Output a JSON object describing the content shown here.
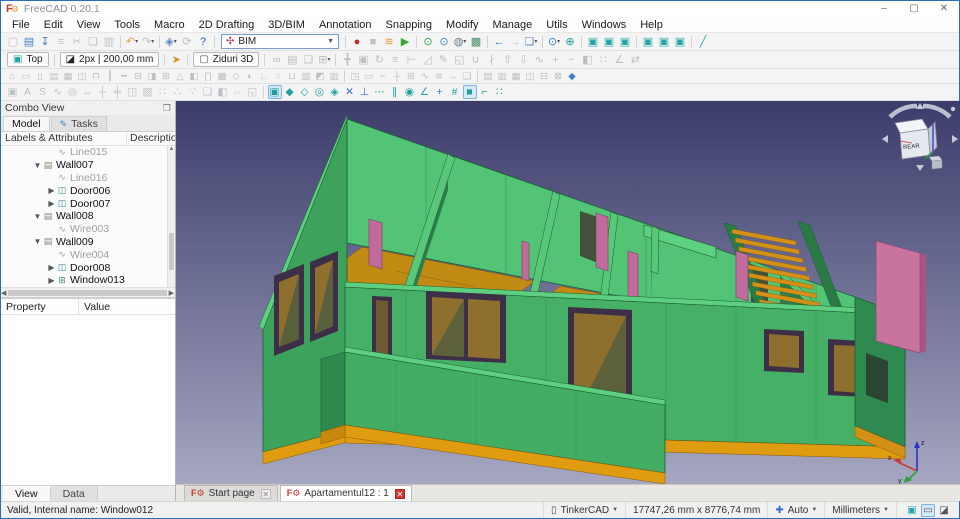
{
  "window": {
    "title": "FreeCAD 0.20.1",
    "controls": [
      {
        "name": "minimize-button",
        "glyph": "–"
      },
      {
        "name": "maximize-button",
        "glyph": "▢"
      },
      {
        "name": "close-button",
        "glyph": "✕"
      }
    ]
  },
  "menu": [
    "File",
    "Edit",
    "View",
    "Tools",
    "Macro",
    "2D Drafting",
    "3D/BIM",
    "Annotation",
    "Snapping",
    "Modify",
    "Manage",
    "Utils",
    "Windows",
    "Help"
  ],
  "toolbars": {
    "row1": [
      {
        "type": "group",
        "name": "file-toolbar",
        "items": [
          {
            "n": "new-file-icon",
            "g": "▢",
            "d": 1
          },
          {
            "n": "open-file-icon",
            "g": "▤",
            "c": "#3f7fc4"
          },
          {
            "n": "save-icon",
            "g": "↧",
            "c": "#3f7fc4"
          },
          {
            "n": "print-icon",
            "g": "≡",
            "d": 1
          },
          {
            "n": "cut-icon",
            "g": "✂",
            "d": 1
          },
          {
            "n": "copy-icon",
            "g": "❏",
            "d": 1
          },
          {
            "n": "paste-icon",
            "g": "▥",
            "d": 1
          }
        ]
      },
      {
        "type": "group",
        "name": "undo-redo-toolbar",
        "items": [
          {
            "n": "undo-icon",
            "g": "↶",
            "c": "#e8a33d",
            "dd": 1
          },
          {
            "n": "redo-icon",
            "g": "↷",
            "d": 1,
            "dd": 1
          }
        ]
      },
      {
        "type": "group",
        "name": "workbench-tools",
        "items": [
          {
            "n": "workbench-icon",
            "g": "◈",
            "c": "#5b8ac4",
            "dd": 1
          },
          {
            "n": "refresh-icon",
            "g": "⟳",
            "d": 1
          },
          {
            "n": "whats-this-icon",
            "g": "?",
            "c": "#2a5fa8"
          }
        ]
      },
      {
        "type": "combo",
        "name": "workbench-selector",
        "icon_glyph": "✣",
        "icon_color": "#c03a52",
        "value": "BIM"
      },
      {
        "type": "group",
        "name": "macro-toolbar",
        "items": [
          {
            "n": "macro-record-icon",
            "g": "●",
            "c": "#cc2626"
          },
          {
            "n": "macro-stop-icon",
            "g": "■",
            "d": 1
          },
          {
            "n": "macro-edit-icon",
            "g": "≋",
            "c": "#e8952a"
          },
          {
            "n": "macro-play-icon",
            "g": "▶",
            "c": "#3aa73a"
          }
        ]
      },
      {
        "type": "group",
        "name": "view-zoom-toolbar",
        "items": [
          {
            "n": "zoom-selection-icon",
            "g": "⊙",
            "c": "#2e9e4f"
          },
          {
            "n": "zoom-icon",
            "g": "⊙",
            "c": "#3f7fc4"
          },
          {
            "n": "draw-style-icon",
            "g": "◍",
            "c": "#6a7f8f",
            "dd": 1
          },
          {
            "n": "texture-view-icon",
            "g": "▩",
            "c": "#4a8f6a"
          }
        ]
      },
      {
        "type": "group",
        "name": "nav-history-toolbar",
        "items": [
          {
            "n": "nav-back-icon",
            "g": "←",
            "c": "#3f7fc4"
          },
          {
            "n": "nav-forward-icon",
            "g": "→",
            "d": 1
          },
          {
            "n": "linked-view-icon",
            "g": "❏",
            "c": "#5b8ac4",
            "dd": 1
          }
        ]
      },
      {
        "type": "group",
        "name": "zoom-fit-toolbar",
        "items": [
          {
            "n": "zoom-in-icon",
            "g": "⊙",
            "c": "#3f7fc4",
            "dd": 1
          },
          {
            "n": "fit-all-icon",
            "g": "⊕",
            "c": "#1f9e9e"
          }
        ]
      },
      {
        "type": "group",
        "name": "std-views-toolbar-1",
        "items": [
          {
            "n": "axonometric-view-icon",
            "g": "▣",
            "c": "#25a7a7"
          },
          {
            "n": "front-view-icon",
            "g": "▣",
            "c": "#25a7a7"
          },
          {
            "n": "top-view-icon",
            "g": "▣",
            "c": "#25a7a7"
          }
        ]
      },
      {
        "type": "group",
        "name": "std-views-toolbar-2",
        "items": [
          {
            "n": "right-view-icon",
            "g": "▣",
            "c": "#25a7a7"
          },
          {
            "n": "rear-view-icon",
            "g": "▣",
            "c": "#25a7a7"
          },
          {
            "n": "bottom-view-icon",
            "g": "▣",
            "c": "#25a7a7"
          }
        ]
      },
      {
        "type": "group",
        "name": "measure-toolbar",
        "items": [
          {
            "n": "measure-icon",
            "g": "╱",
            "c": "#25a7a7"
          }
        ]
      }
    ],
    "row2": [
      {
        "type": "button",
        "name": "current-view-button",
        "glyph": "▣",
        "glyph_color": "#25a7a7",
        "label": "Top"
      },
      {
        "type": "button",
        "name": "line-style-button",
        "glyph": "◪",
        "glyph_color": "#222222",
        "label": "2px | 200,00 mm"
      },
      {
        "type": "group",
        "name": "working-plane-toolbar",
        "items": [
          {
            "n": "working-plane-arrow-icon",
            "g": "➤",
            "c": "#d88c2a"
          }
        ]
      },
      {
        "type": "button",
        "name": "walls-3d-button",
        "glyph": "▢",
        "glyph_color": "#555555",
        "label": "Ziduri 3D"
      },
      {
        "type": "group",
        "name": "group-tools",
        "items": [
          {
            "n": "link-icon",
            "g": "∞",
            "d": 1
          },
          {
            "n": "make-group-icon",
            "g": "▤",
            "d": 1
          },
          {
            "n": "move-to-group-icon",
            "g": "❏",
            "d": 1
          },
          {
            "n": "share-icon",
            "g": "⊞",
            "d": 1,
            "dd": 1
          }
        ]
      },
      {
        "type": "group",
        "name": "modify-tools",
        "items": [
          {
            "n": "draft-move-icon",
            "g": "╋",
            "d": 1
          },
          {
            "n": "draft-copy-icon",
            "g": "▣",
            "d": 1
          },
          {
            "n": "draft-rotate-icon",
            "g": "↻",
            "d": 1
          },
          {
            "n": "draft-offset-icon",
            "g": "≡",
            "d": 1
          },
          {
            "n": "draft-trimex-icon",
            "g": "⊢",
            "d": 1
          },
          {
            "n": "draft-scale-icon",
            "g": "◿",
            "d": 1
          },
          {
            "n": "draft-edit-icon",
            "g": "✎",
            "d": 1
          },
          {
            "n": "draft-subelement-icon",
            "g": "◱",
            "d": 1
          },
          {
            "n": "draft-join-icon",
            "g": "∪",
            "d": 1
          },
          {
            "n": "draft-split-icon",
            "g": "∤",
            "d": 1
          },
          {
            "n": "draft-upgrade-icon",
            "g": "⇧",
            "d": 1
          },
          {
            "n": "draft-downgrade-icon",
            "g": "⇩",
            "d": 1
          },
          {
            "n": "draft-wire-to-spline-icon",
            "g": "∿",
            "d": 1
          },
          {
            "n": "draft-add-point-icon",
            "g": "+",
            "d": 1
          },
          {
            "n": "draft-remove-point-icon",
            "g": "−",
            "d": 1
          },
          {
            "n": "draft-mirror-icon",
            "g": "◧",
            "d": 1
          },
          {
            "n": "draft-array-icon",
            "g": "∷",
            "d": 1
          },
          {
            "n": "draft-slope-icon",
            "g": "∠",
            "d": 1
          },
          {
            "n": "draft-invert-icon",
            "g": "⇄",
            "d": 1
          }
        ]
      }
    ],
    "row3": [
      {
        "type": "group",
        "name": "bim-tools",
        "items": [
          {
            "n": "bim-project-icon",
            "g": "⌂",
            "d": 1
          },
          {
            "n": "bim-site-icon",
            "g": "▭",
            "d": 1
          },
          {
            "n": "bim-building-icon",
            "g": "▯",
            "d": 1
          },
          {
            "n": "bim-level-icon",
            "g": "▤",
            "d": 1
          },
          {
            "n": "bim-space-icon",
            "g": "▦",
            "d": 1
          },
          {
            "n": "bim-wall-icon",
            "g": "◫",
            "d": 1
          },
          {
            "n": "bim-curtain-wall-icon",
            "g": "⊓",
            "d": 1
          },
          {
            "n": "bim-column-icon",
            "g": "┃",
            "d": 1
          },
          {
            "n": "bim-beam-icon",
            "g": "━",
            "d": 1
          },
          {
            "n": "bim-slab-icon",
            "g": "⊟",
            "d": 1
          },
          {
            "n": "bim-door-icon",
            "g": "◨",
            "d": 1
          },
          {
            "n": "bim-window-icon",
            "g": "⊞",
            "d": 1
          },
          {
            "n": "bim-roof-icon",
            "g": "△",
            "d": 1
          },
          {
            "n": "bim-panel-icon",
            "g": "◧",
            "d": 1
          },
          {
            "n": "bim-frame-icon",
            "g": "∏",
            "d": 1
          },
          {
            "n": "bim-fence-icon",
            "g": "▩",
            "d": 1
          },
          {
            "n": "bim-truss-icon",
            "g": "◇",
            "d": 1
          },
          {
            "n": "bim-equipment-icon",
            "g": "◐",
            "d": 1
          },
          {
            "n": "bim-rebar-icon",
            "g": "∟",
            "d": 1
          },
          {
            "n": "bim-pipe-icon",
            "g": "○",
            "d": 1
          },
          {
            "n": "bim-connector-icon",
            "g": "⊔",
            "d": 1
          },
          {
            "n": "bim-stairs-icon",
            "g": "▨",
            "d": 1
          },
          {
            "n": "bim-material-icon",
            "g": "◩",
            "d": 1
          },
          {
            "n": "bim-schedule-icon",
            "g": "▥",
            "d": 1
          }
        ]
      },
      {
        "type": "group",
        "name": "bim-annotation-tools",
        "items": [
          {
            "n": "bim-section-plane-icon",
            "g": "◳",
            "d": 1
          },
          {
            "n": "bim-drawing-icon",
            "g": "▭",
            "d": 1
          },
          {
            "n": "bim-annotation-icon",
            "g": "⌐",
            "d": 1
          },
          {
            "n": "bim-axis-icon",
            "g": "┼",
            "d": 1
          },
          {
            "n": "bim-grid-icon",
            "g": "⊞",
            "d": 1
          },
          {
            "n": "bim-sketch-icon",
            "g": "∿",
            "d": 1
          },
          {
            "n": "bim-text-icon",
            "g": "≋",
            "d": 1
          },
          {
            "n": "bim-dimension-icon",
            "g": "↔",
            "d": 1
          },
          {
            "n": "bim-clone-icon",
            "g": "❏",
            "d": 1
          }
        ]
      },
      {
        "type": "group",
        "name": "ifc-tools",
        "items": [
          {
            "n": "ifc-explore-icon",
            "g": "▤",
            "d": 1
          },
          {
            "n": "ifc-diff-icon",
            "g": "▥",
            "d": 1
          },
          {
            "n": "ifc-expand-icon",
            "g": "▦",
            "d": 1
          },
          {
            "n": "ifc-compress-icon",
            "g": "◫",
            "d": 1
          },
          {
            "n": "ifc-convert-icon",
            "g": "⊟",
            "d": 1
          },
          {
            "n": "ifc-lock-icon",
            "g": "⊠",
            "d": 1
          },
          {
            "n": "views-manager-icon",
            "g": "◆",
            "c": "#3f7fc4"
          }
        ]
      }
    ],
    "row4": [
      {
        "type": "group",
        "name": "draft-annotation-tools",
        "items": [
          {
            "n": "image-plane-icon",
            "g": "▣",
            "d": 1
          },
          {
            "n": "shape-text-icon",
            "g": "A",
            "d": 1
          },
          {
            "n": "shape-string-icon",
            "g": "S",
            "d": 1
          },
          {
            "n": "bezier-icon",
            "g": "∿",
            "d": 1
          },
          {
            "n": "label-icon",
            "g": "◎",
            "d": 1
          },
          {
            "n": "dimension-icon",
            "g": "↔",
            "d": 1
          },
          {
            "n": "axis-icon",
            "g": "┼",
            "d": 1
          },
          {
            "n": "axis-system-icon",
            "g": "╪",
            "d": 1
          },
          {
            "n": "section-icon",
            "g": "◫",
            "d": 1
          },
          {
            "n": "hatch-icon",
            "g": "▨",
            "d": 1
          },
          {
            "n": "ortho-array-icon",
            "g": "∷",
            "d": 1
          },
          {
            "n": "path-array-icon",
            "g": "∴",
            "d": 1
          },
          {
            "n": "point-array-icon",
            "g": "∵",
            "d": 1
          },
          {
            "n": "clone-icon",
            "g": "❏",
            "d": 1
          },
          {
            "n": "mirror-icon",
            "g": "◧",
            "d": 1
          },
          {
            "n": "stretch-icon",
            "g": "⇔",
            "d": 1
          },
          {
            "n": "shape-2d-view-icon",
            "g": "◱",
            "d": 1
          }
        ]
      },
      {
        "type": "group",
        "name": "snapping-toolbar",
        "items": [
          {
            "n": "snap-lock-icon",
            "g": "▣",
            "c": "#1f9e9e",
            "a": 1
          },
          {
            "n": "snap-endpoint-icon",
            "g": "◆",
            "c": "#1f9e9e"
          },
          {
            "n": "snap-midpoint-icon",
            "g": "◇",
            "c": "#1f9e9e"
          },
          {
            "n": "snap-center-icon",
            "g": "◎",
            "c": "#1f9e9e"
          },
          {
            "n": "snap-angle-icon",
            "g": "◈",
            "c": "#1f9e9e"
          },
          {
            "n": "snap-intersection-icon",
            "g": "✕",
            "c": "#2f6fd0"
          },
          {
            "n": "snap-perpendicular-icon",
            "g": "⊥",
            "c": "#2f6fd0"
          },
          {
            "n": "snap-extension-icon",
            "g": "⋯",
            "c": "#1f9e9e"
          },
          {
            "n": "snap-parallel-icon",
            "g": "∥",
            "c": "#1f9e9e"
          },
          {
            "n": "snap-special-icon",
            "g": "◉",
            "c": "#1f9e9e"
          },
          {
            "n": "snap-near-icon",
            "g": "∠",
            "c": "#1f9e9e"
          },
          {
            "n": "snap-ortho-icon",
            "g": "+",
            "c": "#2f6fd0"
          },
          {
            "n": "snap-grid-icon",
            "g": "#",
            "c": "#1f9e9e"
          },
          {
            "n": "snap-working-plane-icon",
            "g": "■",
            "c": "#1f9e9e",
            "a": 1
          },
          {
            "n": "snap-dimensions-icon",
            "g": "⌐",
            "c": "#1f9e9e"
          },
          {
            "n": "toggle-grid-icon",
            "g": "∷",
            "c": "#1f9e9e"
          }
        ]
      }
    ]
  },
  "combo_view": {
    "title": "Combo View",
    "tabs": [
      {
        "label": "Model",
        "active": true
      },
      {
        "label": "Tasks",
        "active": false,
        "icon": "✎"
      }
    ],
    "tree_header": {
      "col1": "Labels & Attributes",
      "col2": "Descriptio"
    },
    "icon_map": {
      "line": {
        "g": "∿",
        "c": "#9aa0a6"
      },
      "wall": {
        "g": "▤",
        "c": "#7d8a70"
      },
      "door": {
        "g": "◫",
        "c": "#3f8f8f"
      },
      "window": {
        "g": "⊞",
        "c": "#3f8f8f"
      }
    },
    "tree": [
      {
        "label": "Line015",
        "icon": "line",
        "depth": 2,
        "muted": true
      },
      {
        "label": "Wall007",
        "icon": "wall",
        "depth": 1,
        "expanded": true
      },
      {
        "label": "Line016",
        "icon": "line",
        "depth": 2,
        "muted": true
      },
      {
        "label": "Door006",
        "icon": "door",
        "depth": 2,
        "collapsed": true
      },
      {
        "label": "Door007",
        "icon": "door",
        "depth": 2,
        "collapsed": true
      },
      {
        "label": "Wall008",
        "icon": "wall",
        "depth": 1,
        "expanded": true
      },
      {
        "label": "Wire003",
        "icon": "line",
        "depth": 2,
        "muted": true
      },
      {
        "label": "Wall009",
        "icon": "wall",
        "depth": 1,
        "expanded": true
      },
      {
        "label": "Wire004",
        "icon": "line",
        "depth": 2,
        "muted": true
      },
      {
        "label": "Door008",
        "icon": "door",
        "depth": 2,
        "collapsed": true
      },
      {
        "label": "Window013",
        "icon": "window",
        "depth": 2,
        "collapsed": true
      }
    ],
    "property_table": {
      "columns": [
        "Property",
        "Value"
      ],
      "rows": []
    },
    "bottom_tabs": [
      {
        "label": "View",
        "active": true
      },
      {
        "label": "Data",
        "active": false
      }
    ]
  },
  "document_tabs": [
    {
      "label": "Start page",
      "active": false
    },
    {
      "label": "Apartamentul12 : 1",
      "active": true
    }
  ],
  "viewport": {
    "nav_cube_face_label": "REAR",
    "axis_labels": {
      "x": "x",
      "y": "y",
      "z": "z"
    },
    "colors": {
      "bg_top": "#3c3c6b",
      "bg_bottom": "#a6a7c0",
      "wall_bright": "#53c475",
      "wall_front": "#46b066",
      "wall_dark": "#2f8a4f",
      "floor": "#c18a12",
      "plinth": "#e09c10",
      "door_panel": "#c06b9b",
      "window_frame": "#3c2f47",
      "glass": "#8f6f2e"
    }
  },
  "status_bar": {
    "message": "Valid, Internal name: Window012",
    "nav_style_label": "TinkerCAD",
    "dimension_readout": "17747,26 mm x 8776,74 mm",
    "snap_label": "Auto",
    "units_label": "Millimeters"
  }
}
